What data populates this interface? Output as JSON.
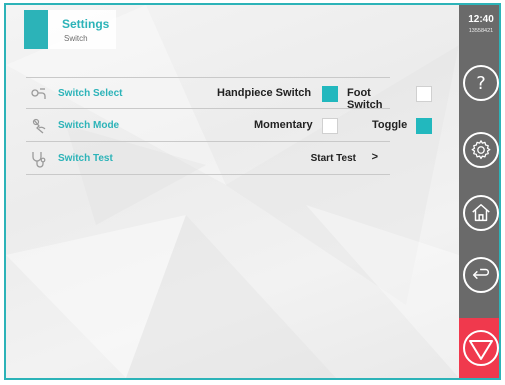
{
  "header": {
    "title": "Settings",
    "subtitle": "Switch"
  },
  "rows": [
    {
      "label": "Switch Select",
      "icon": "switch-select-icon",
      "options": [
        {
          "label": "Handpiece Switch",
          "checked": true
        },
        {
          "label": "Foot Switch",
          "checked": false
        }
      ]
    },
    {
      "label": "Switch Mode",
      "icon": "switch-mode-icon",
      "options": [
        {
          "label": "Momentary",
          "checked": false
        },
        {
          "label": "Toggle",
          "checked": true
        }
      ]
    },
    {
      "label": "Switch Test",
      "icon": "stethoscope-icon",
      "action": {
        "label": "Start Test",
        "chevron": ">"
      }
    }
  ],
  "sidebar": {
    "time": "12:40",
    "serial": "13558421",
    "buttons": [
      {
        "name": "help",
        "icon": "question-icon",
        "glyph": "?"
      },
      {
        "name": "settings",
        "icon": "gear-icon"
      },
      {
        "name": "home",
        "icon": "home-icon"
      },
      {
        "name": "back",
        "icon": "back-arrow-icon"
      }
    ],
    "stop": {
      "icon": "stop-triangle-icon"
    }
  },
  "colors": {
    "accent": "#2cb3b8",
    "sidebar": "#6a6a6a",
    "stop": "#f0394d",
    "checked": "#22b8be"
  }
}
